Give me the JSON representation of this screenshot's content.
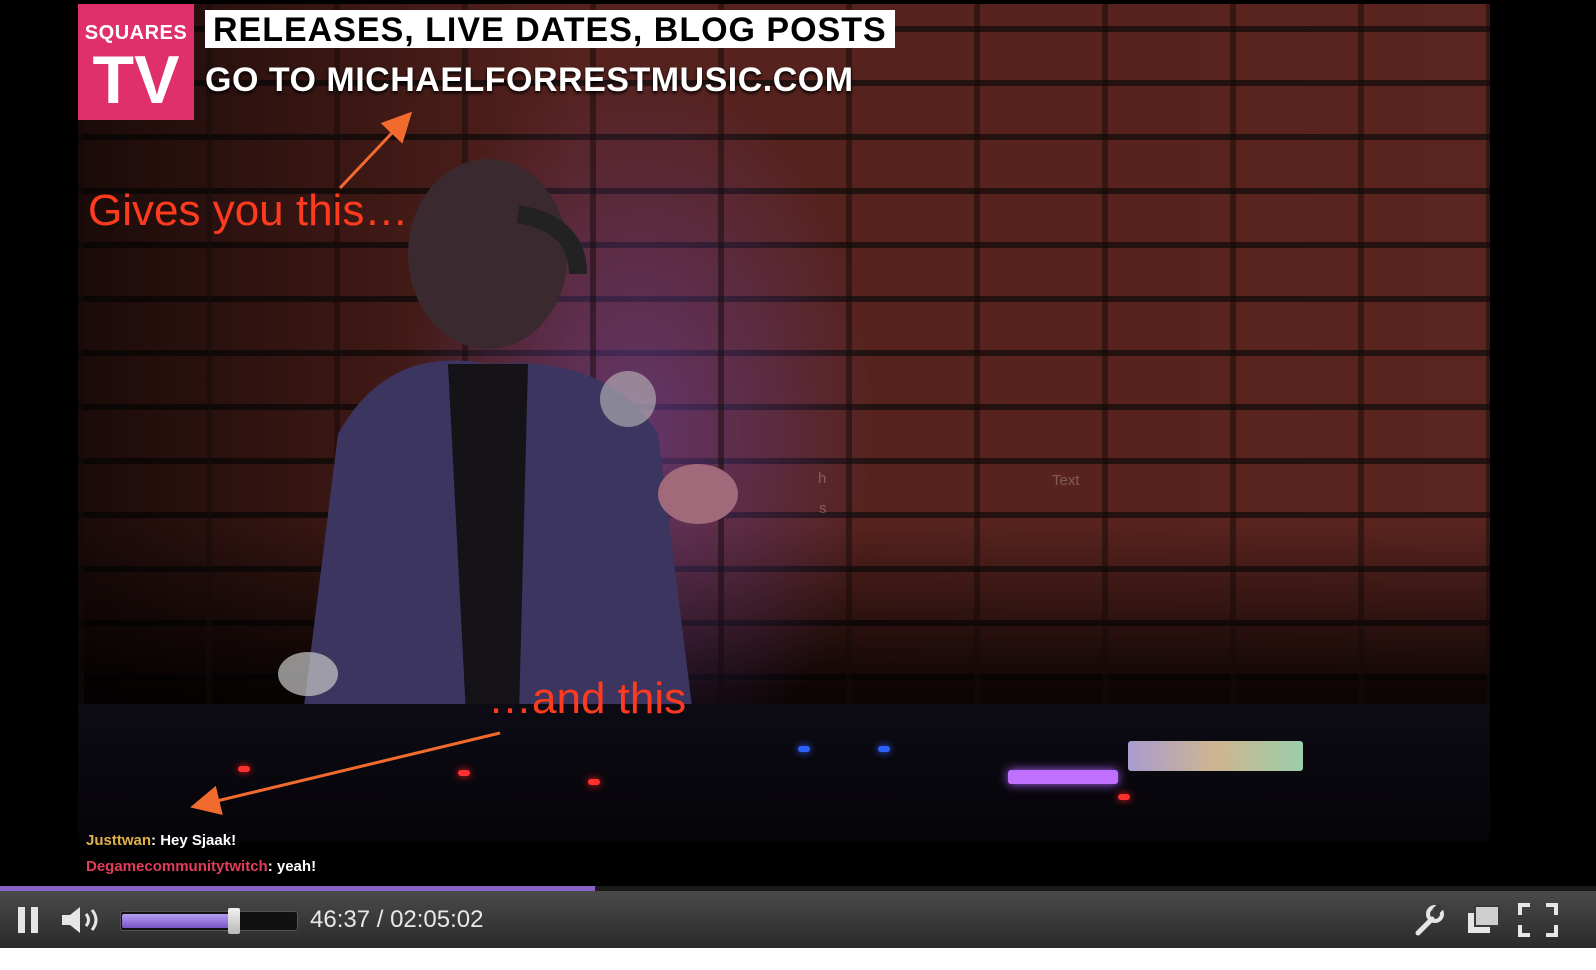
{
  "overlay": {
    "logo_top": "SQUARES",
    "logo_big": "TV",
    "banner_line1": "RELEASES, LIVE DATES, BLOG POSTS",
    "banner_line2": "GO TO MICHAELFORRESTMUSIC.COM"
  },
  "annotations": {
    "top": "Gives you this…",
    "bottom": "…and this",
    "color": "#ff3b1f"
  },
  "chat": [
    {
      "user": "Justtwan",
      "sep": ": ",
      "text": "Hey Sjaak!",
      "color": "#e0b14a"
    },
    {
      "user": "Degamecommunitytwitch",
      "sep": ": ",
      "text": "yeah!",
      "color": "#e43c5a"
    }
  ],
  "ghost_text": {
    "a": "h",
    "b": "s",
    "c": "Text"
  },
  "player": {
    "time_display": "46:37 / 02:05:02",
    "progress_fraction": 0.373,
    "volume_fraction": 0.65,
    "accent": "#8a63c9",
    "icons": [
      "pause-icon",
      "volume-icon",
      "settings-wrench-icon",
      "popout-icon",
      "fullscreen-icon"
    ]
  }
}
